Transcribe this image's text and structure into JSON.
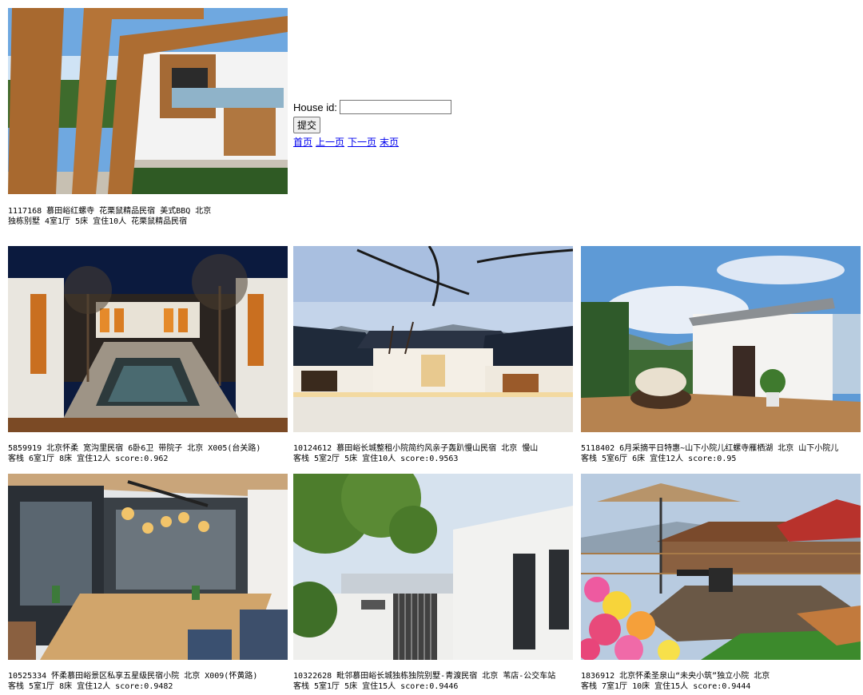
{
  "form": {
    "house_id_label": "House id:",
    "house_id_value": "",
    "submit_label": "提交"
  },
  "pager": {
    "first": "首页",
    "prev": "上一页",
    "next": "下一页",
    "last": "末页"
  },
  "query": {
    "line1": "1117168 慕田峪红螺寺 花栗鼠精品民宿 美式BBQ 北京",
    "line2": "独栋别墅 4室1厅  5床  宜住10人 花栗鼠精品民宿"
  },
  "results": [
    {
      "line1": "5859919 北京怀柔 宽沟里民宿 6卧6卫 带院子 北京 X005(台关路)",
      "line2": "客栈 6室1厅  8床  宜住12人 score:0.962"
    },
    {
      "line1": "10124612 慕田峪长城整租小院简约风亲子轰趴慢山民宿 北京 慢山",
      "line2": "客栈 5室2厅  5床  宜住10人 score:0.9563"
    },
    {
      "line1": "5118402 6月采摘平日特惠~山下小院儿红螺寺雁栖湖 北京  山下小院儿",
      "line2": "客栈 5室6厅  6床  宜住12人 score:0.95"
    },
    {
      "line1": "10525334 怀柔慕田峪景区私享五星级民宿小院 北京 X009(怀黄路)",
      "line2": "客栈 5室1厅  8床  宜住12人 score:0.9482"
    },
    {
      "line1": "10322628 毗邻慕田峪长城独栋独院别墅-青渡民宿 北京 苇店-公交车站",
      "line2": "客栈 5室1厅  5床  宜住15人 score:0.9446"
    },
    {
      "line1": "1836912 北京怀柔圣泉山“未央小筑”独立小院 北京",
      "line2": "客栈 7室1厅  10床  宜住15人 score:0.9444"
    }
  ]
}
